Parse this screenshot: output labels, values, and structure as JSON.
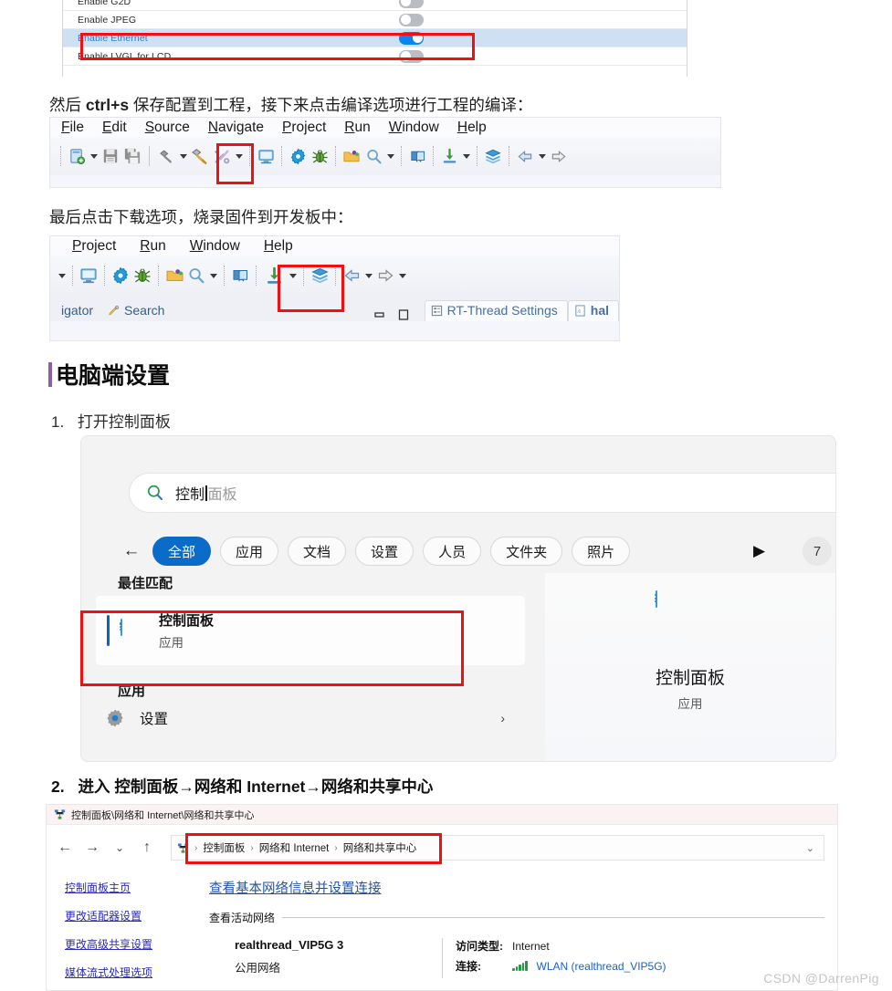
{
  "settings_panel": {
    "rows": [
      {
        "label": "Enable G2D",
        "toggle": "off",
        "selected": false
      },
      {
        "label": "Enable JPEG",
        "toggle": "off",
        "selected": false
      },
      {
        "label": "Enable Ethernet",
        "toggle": "on",
        "selected": true
      },
      {
        "label": "Enable LVGL for LCD",
        "toggle": "off",
        "selected": false
      }
    ]
  },
  "prose": {
    "line1_pre": "然后 ",
    "line1_bold": "ctrl+s",
    "line1_post": " 保存配置到工程，接下来点击编译选项进行工程的编译：",
    "line2": "最后点击下载选项，烧录固件到开发板中："
  },
  "ide_build": {
    "menu": [
      "File",
      "Edit",
      "Source",
      "Navigate",
      "Project",
      "Run",
      "Window",
      "Help"
    ],
    "toolbar_icons": [
      "new-file-icon",
      "dropdown-caret",
      "save-icon",
      "save-all-icon",
      "hammer-icon",
      "dropdown-caret",
      "build-all-icon",
      "tools-icon",
      "dropdown-caret",
      "console-icon",
      "settings-gear-icon",
      "debug-bug-icon",
      "open-folder-icon",
      "search-icon",
      "dropdown-caret",
      "book-icon",
      "download-icon",
      "dropdown-caret",
      "layers-icon",
      "back-arrow-icon",
      "dropdown-caret",
      "forward-arrow-icon"
    ]
  },
  "ide_download": {
    "menu": [
      "Project",
      "Run",
      "Window",
      "Help"
    ],
    "toolbar_icons": [
      "dropdown-caret",
      "console-icon",
      "settings-gear-icon",
      "debug-bug-icon",
      "open-folder-icon",
      "search-icon",
      "dropdown-caret",
      "book-icon",
      "download-icon",
      "dropdown-caret",
      "layers-icon",
      "back-arrow-icon",
      "dropdown-caret",
      "forward-arrow-icon",
      "dropdown-caret"
    ],
    "tabs": [
      {
        "label": "igator",
        "icon": "none"
      },
      {
        "label": "Search",
        "icon": "search-pencil-icon"
      },
      {
        "label": "RT-Thread Settings",
        "icon": "settings-list-icon"
      },
      {
        "label": "hal",
        "icon": "c-file-icon"
      }
    ],
    "minimize_restore": [
      "minimize-icon",
      "maximize-icon"
    ]
  },
  "heading": "电脑端设置",
  "steps": {
    "step1_num": "1.",
    "step1_text": "打开控制面板",
    "step2_num": "2.",
    "step2_text": "进入 控制面板→网络和 Internet→网络和共享中心"
  },
  "win_search": {
    "query": "控制",
    "query_tail": "面板",
    "search_icon": "search-icon",
    "back_icon": "back-arrow-icon",
    "chips": [
      "全部",
      "应用",
      "文档",
      "设置",
      "人员",
      "文件夹",
      "照片"
    ],
    "active_chip": "全部",
    "next_arrow": "play-arrow-icon",
    "count_badge": "7",
    "best_match_title": "最佳匹配",
    "best_match": {
      "title": "控制面板",
      "subtitle": "应用",
      "icon": "control-panel-icon"
    },
    "apps_title": "应用",
    "apps": [
      {
        "label": "设置",
        "icon": "settings-gear-icon",
        "chevron": "chevron-right-icon"
      }
    ],
    "preview": {
      "title": "控制面板",
      "subtitle": "应用",
      "icon": "control-panel-icon"
    }
  },
  "explorer": {
    "window_title": "控制面板\\网络和 Internet\\网络和共享中心",
    "window_icon": "network-sharing-icon",
    "nav_icons": [
      "back-arrow-icon",
      "forward-arrow-icon",
      "recent-caret-icon",
      "up-arrow-icon"
    ],
    "address_icon": "network-sharing-icon",
    "breadcrumb": [
      "控制面板",
      "网络和 Internet",
      "网络和共享中心"
    ],
    "breadcrumb_sep": "›",
    "address_caret": "chevron-down-icon",
    "sidebar_links": [
      "控制面板主页",
      "更改适配器设置",
      "更改高级共享设置",
      "媒体流式处理选项"
    ],
    "main_header": "查看基本网络信息并设置连接",
    "sub_header": "查看活动网络",
    "network": {
      "name": "realthread_VIP5G 3",
      "type": "公用网络",
      "access_label": "访问类型:",
      "access_value": "Internet",
      "conn_label": "连接:",
      "conn_value": "WLAN (realthread_VIP5G)",
      "conn_icon": "wifi-signal-icon"
    }
  },
  "watermark": "CSDN @DarrenPig",
  "colors": {
    "toggle_on": "#0a84f0",
    "toggle_off": "#b9bcc0",
    "highlight_red": "#ee1111",
    "chip_active": "#0b6bc9",
    "heading_bar": "#8b5fa8",
    "link_blue": "#2b2bb5"
  }
}
